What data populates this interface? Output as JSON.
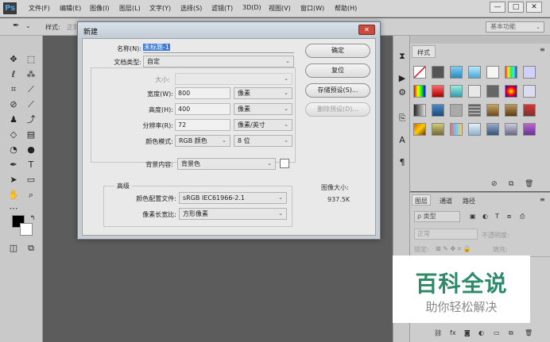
{
  "app": {
    "logo": "Ps"
  },
  "menubar": {
    "items": [
      "文件(F)",
      "编辑(E)",
      "图像(I)",
      "图层(L)",
      "文字(Y)",
      "选择(S)",
      "滤镜(T)",
      "3D(D)",
      "视图(V)",
      "窗口(W)",
      "帮助(H)"
    ],
    "win_min": "—",
    "win_max": "□",
    "win_close": "✕"
  },
  "options_bar": {
    "style_label": "样式:",
    "style_value": "正常",
    "workspace": "基本功能"
  },
  "dialog": {
    "title": "新建",
    "name_label": "名称(N):",
    "name_value": "未标题-1",
    "doc_type_label": "文档类型:",
    "doc_type_value": "自定",
    "size_label": "大小:",
    "width_label": "宽度(W):",
    "width_value": "800",
    "width_unit": "像素",
    "height_label": "高度(H):",
    "height_value": "400",
    "height_unit": "像素",
    "resolution_label": "分辨率(R):",
    "resolution_value": "72",
    "resolution_unit": "像素/英寸",
    "color_mode_label": "颜色模式:",
    "color_mode_value": "RGB 颜色",
    "bit_depth": "8 位",
    "background_label": "背景内容:",
    "background_value": "背景色",
    "advanced_label": "高级",
    "color_profile_label": "颜色配置文件:",
    "color_profile_value": "sRGB IEC61966-2.1",
    "pixel_aspect_label": "像素长宽比:",
    "pixel_aspect_value": "方形像素",
    "buttons": {
      "ok": "确定",
      "reset": "复位",
      "save_preset": "存储预设(S)...",
      "delete_preset": "删除预设(D)..."
    },
    "image_size_label": "图像大小:",
    "image_size_value": "937.5K"
  },
  "styles_panel": {
    "tab": "样式"
  },
  "layers_panel": {
    "tabs": [
      "图层",
      "通道",
      "路径"
    ],
    "kind_label": "ρ 类型",
    "blend_mode": "正常",
    "opacity_label": "不透明度:",
    "lock_label": "锁定:",
    "fill_label": "填充:"
  },
  "watermark": {
    "title": "百科全说",
    "subtitle": "助你轻松解决"
  },
  "colors": {
    "accent": "#2f8a6a",
    "selection": "#3a7bd5"
  }
}
